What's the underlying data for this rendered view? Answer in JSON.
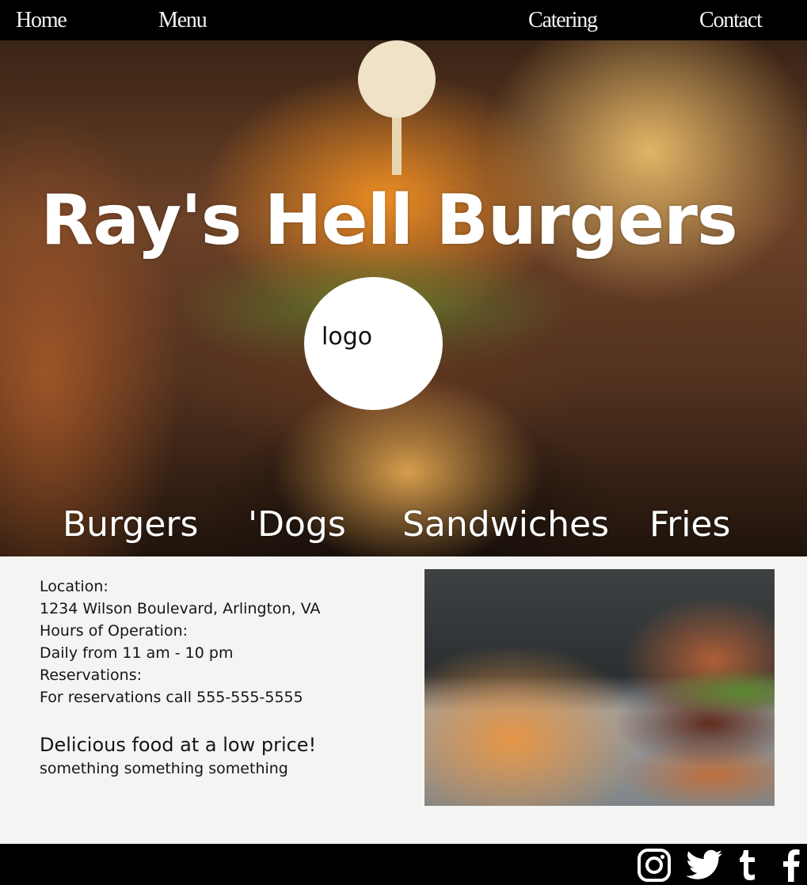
{
  "nav": {
    "home": "Home",
    "menu": "Menu",
    "catering": "Catering",
    "contact": "Contact"
  },
  "hero": {
    "title": "Ray's Hell Burgers",
    "logo_text": "logo",
    "categories": [
      "Burgers",
      "'Dogs",
      "Sandwiches",
      "Fries"
    ]
  },
  "info": {
    "location_label": "Location:",
    "location": "1234 Wilson Boulevard, Arlington, VA",
    "hours_label": "Hours of Operation:",
    "hours": "Daily from 11 am - 10 pm",
    "reservations_label": "Reservations:",
    "reservations": "For reservations call 555-555-5555",
    "tagline": "Delicious food at a low price!",
    "subtagline": "something something something"
  },
  "footer": {
    "social_icons": [
      "instagram-icon",
      "twitter-icon",
      "tumblr-icon",
      "facebook-icon"
    ]
  },
  "colors": {
    "nav_bg": "#000000",
    "footer_bg": "#000000",
    "content_bg": "#f4f4f2",
    "hero_text": "#ffffff"
  }
}
